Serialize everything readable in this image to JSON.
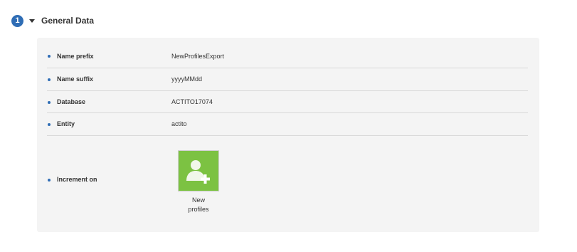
{
  "section": {
    "step_number": "1",
    "title": "General Data"
  },
  "fields": [
    {
      "label": "Name prefix",
      "value": "NewProfilesExport"
    },
    {
      "label": "Name suffix",
      "value": "yyyyMMdd"
    },
    {
      "label": "Database",
      "value": "ACTITO17074"
    },
    {
      "label": "Entity",
      "value": "actito"
    },
    {
      "label": "Increment on"
    }
  ],
  "increment_option": {
    "label_line1": "New",
    "label_line2": "profiles",
    "icon": "add-user-icon",
    "color": "#7cc242"
  },
  "colors": {
    "accent": "#2f6db5",
    "panel_background": "#f4f4f4",
    "divider": "#d9d9d9"
  }
}
